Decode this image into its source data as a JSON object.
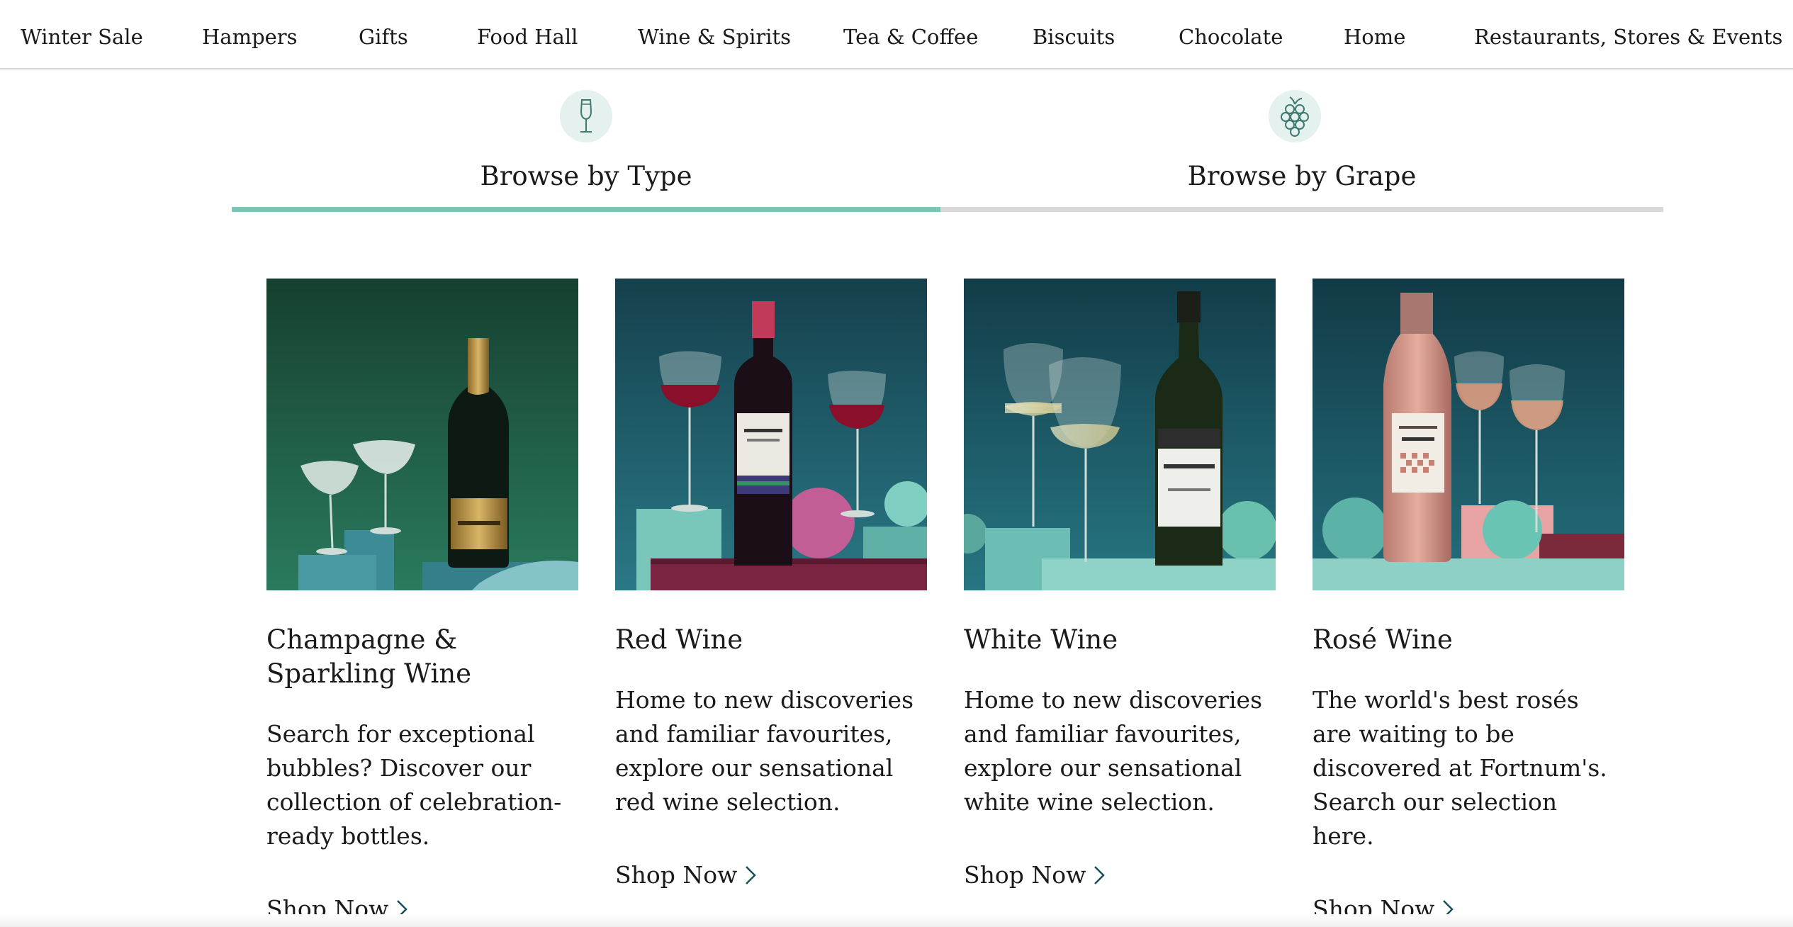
{
  "nav": {
    "items": [
      "Winter Sale",
      "Hampers",
      "Gifts",
      "Food Hall",
      "Wine & Spirits",
      "Tea & Coffee",
      "Biscuits",
      "Chocolate",
      "Home",
      "Restaurants, Stores & Events"
    ]
  },
  "browse_tabs": [
    {
      "label": "Browse by Type",
      "icon": "wine-glass-icon",
      "active": true
    },
    {
      "label": "Browse by Grape",
      "icon": "grapes-icon",
      "active": false
    }
  ],
  "colors": {
    "accent": "#7cc4b4",
    "inactive_bar": "#d9d9d9",
    "icon_circle": "#e4f1ee",
    "icon_stroke": "#3f7a70"
  },
  "cards": [
    {
      "title": "Champagne & Sparkling Wine",
      "description": "Search for exceptional bubbles? Discover our collection of celebration-ready bottles.",
      "link": "Shop Now"
    },
    {
      "title": "Red Wine",
      "description": "Home to new discoveries and familiar favourites, explore our sensational red wine selection.",
      "link": "Shop Now"
    },
    {
      "title": "White Wine",
      "description": "Home to new discoveries and familiar favourites, explore our sensational white wine selection.",
      "link": "Shop Now"
    },
    {
      "title": "Rosé Wine",
      "description": "The world's best rosés are waiting to be discovered at Fortnum's. Search our selection here.",
      "link": "Shop Now"
    }
  ]
}
